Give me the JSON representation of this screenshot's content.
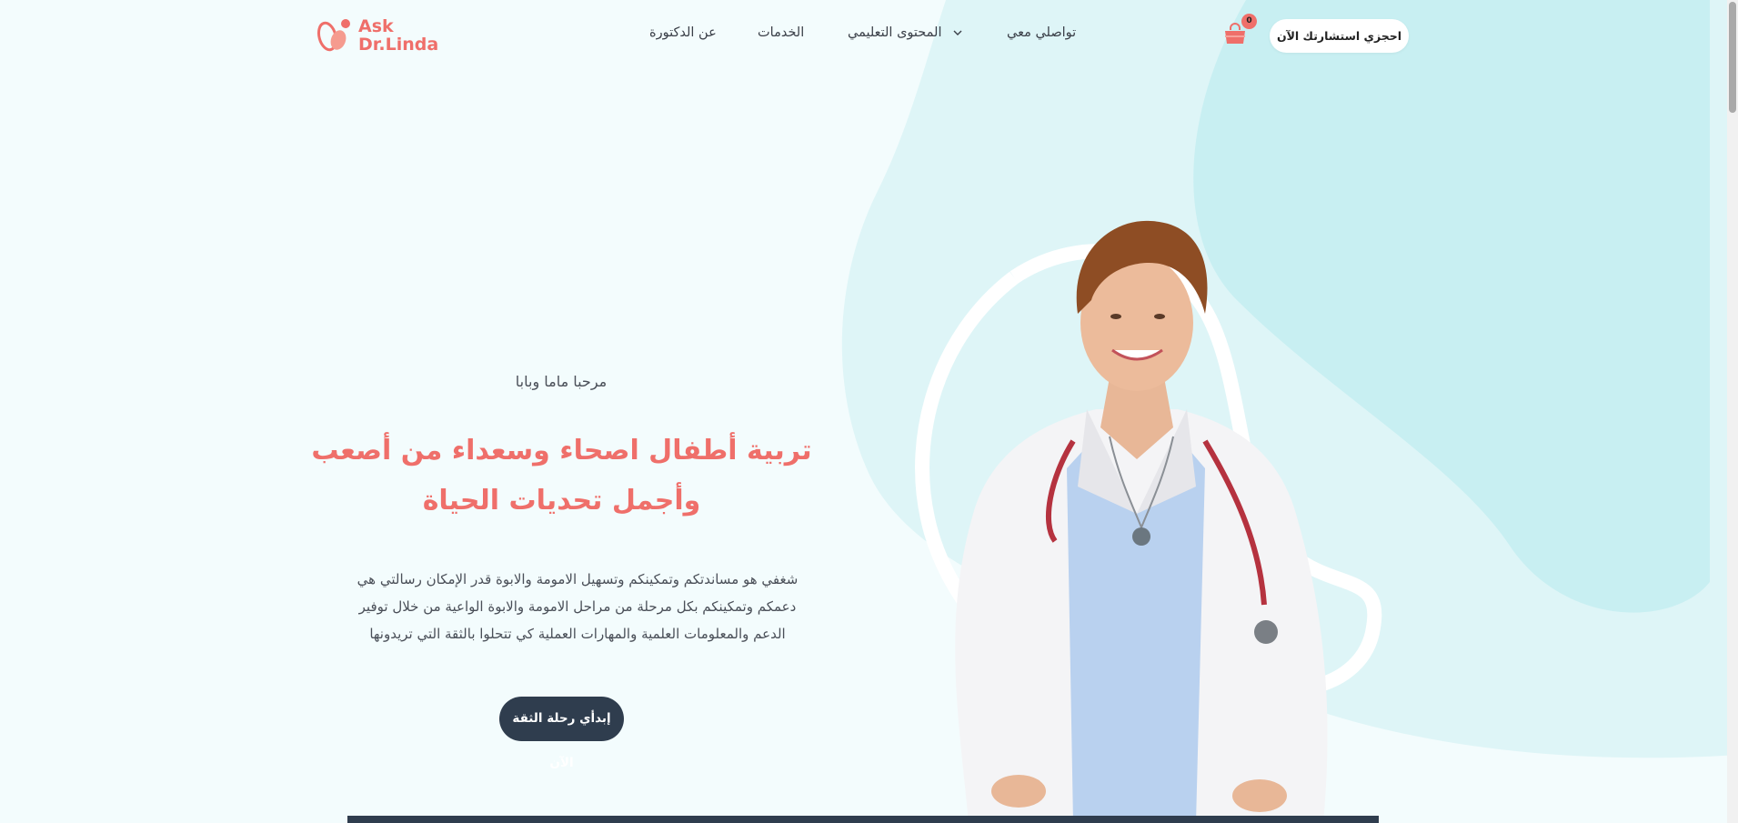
{
  "brand": {
    "logo_line1": "Ask",
    "logo_line2": "Dr.Linda",
    "accent_color": "#ef6f6a",
    "dark_color": "#2f3d4e"
  },
  "nav": {
    "about": "عن الدكتورة",
    "services": "الخدمات",
    "educational": "المحتوى التعليمي",
    "contact": "تواصلي معي"
  },
  "cart": {
    "count": "0",
    "icon": "shopping-bag-icon"
  },
  "header_cta": "احجزي استشارتك الآن",
  "hero": {
    "greeting": "مرحبا ماما وبابا",
    "headline": "تربية أطفال اصحاء وسعداء من أصعب وأجمل تحديات الحياة",
    "paragraph": "شغفي هو مساندتكم وتمكينكم وتسهيل الامومة والابوة قدر الإمكان رسالتي هي دعمكم وتمكينكم بكل مرحلة من مراحل الامومة والابوة الواعية من خلال توفير الدعم والمعلومات العلمية والمهارات العملية كي تتحلوا بالثقة التي تريدونها",
    "cta": "إبدأي رحلة الثقة الآن"
  }
}
